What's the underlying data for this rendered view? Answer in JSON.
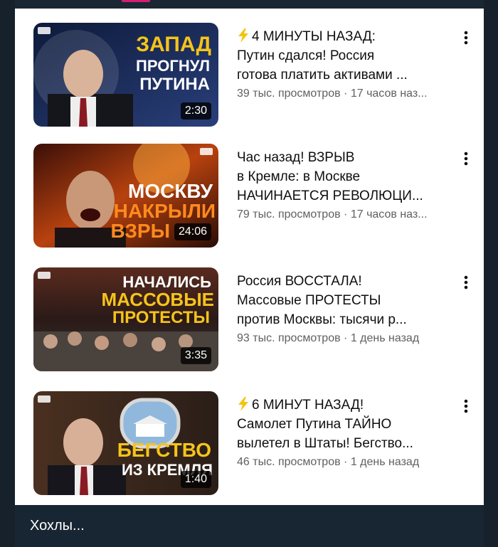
{
  "feed": {
    "videos": [
      {
        "title_prefix_icon": "lightning-icon",
        "title": "4 МИНУТЫ НАЗАД:\nПутин сдался! Россия\nготова платить активами ...",
        "views": "39 тыс. просмотров",
        "separator": "·",
        "age": "17 часов наз...",
        "duration": "2:30",
        "thumb_text": [
          "ЗАПАД",
          "ПРОГНУЛ",
          "ПУТИНА"
        ],
        "thumb_palette": {
          "bg": "#1a2a55",
          "accent": "#f5c41a",
          "text2": "#ffffff"
        }
      },
      {
        "title_prefix_icon": "",
        "title": "Час назад! ВЗРЫВ\nв Кремле: в Москве\nНАЧИНАЕТСЯ РЕВОЛЮЦИ...",
        "views": "79 тыс. просмотров",
        "separator": "·",
        "age": "17 часов наз...",
        "duration": "24:06",
        "thumb_text": [
          "МОСКВУ",
          "НАКРЫЛИ",
          "ВЗРЫ"
        ],
        "thumb_palette": {
          "bg": "#4a1a0c",
          "accent": "#ff8a1e",
          "text2": "#ffffff"
        }
      },
      {
        "title_prefix_icon": "",
        "title": "Россия ВОССТАЛА!\nМассовые ПРОТЕСТЫ\nпротив Москвы: тысячи р...",
        "views": "93 тыс. просмотров",
        "separator": "·",
        "age": "1 день назад",
        "duration": "3:35",
        "thumb_text": [
          "НАЧАЛИСЬ",
          "МАССОВЫЕ",
          "ПРОТЕСТЫ"
        ],
        "thumb_palette": {
          "bg": "#2a1a16",
          "accent": "#f5c41a",
          "text2": "#ffffff"
        }
      },
      {
        "title_prefix_icon": "lightning-icon",
        "title": "6 МИНУТ НАЗАД!\nСамолет Путина ТАЙНО\nвылетел в Штаты! Бегство...",
        "views": "46 тыс. просмотров",
        "separator": "·",
        "age": "1 день назад",
        "duration": "1:40",
        "thumb_text": [
          "БЕГСТВО",
          "ИЗ КРЕМЛЯ"
        ],
        "thumb_palette": {
          "bg": "#3a2418",
          "accent": "#f5c41a",
          "text2": "#ffffff"
        }
      }
    ]
  },
  "message": {
    "caption": "Хохлы..."
  },
  "colors": {
    "chat_bg": "#17212b",
    "caption_bar": "#182533",
    "title_text": "#0f0f0f",
    "meta_text": "#606060",
    "lightning": "#f2c40f"
  }
}
